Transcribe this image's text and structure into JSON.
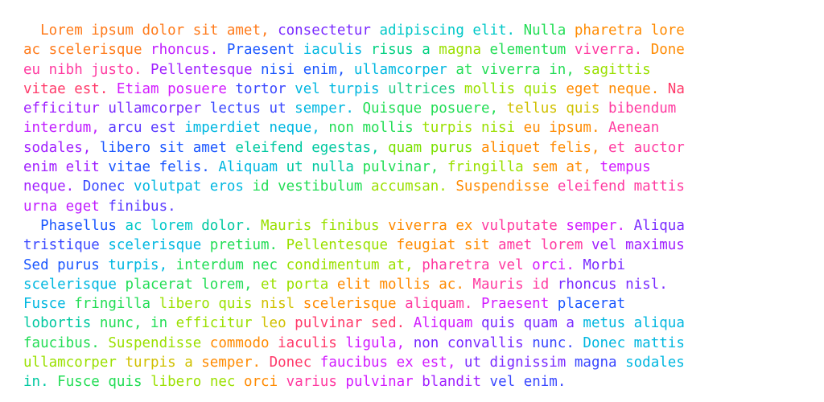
{
  "document": {
    "paragraphs": [
      {
        "lines": [
          [
            [
              "  Lorem ipsum dolor sit amet, ",
              "#ff7a1a"
            ],
            [
              "consectetur ",
              "#7a2bff"
            ],
            [
              "adipiscing elit. ",
              "#00c8c8"
            ],
            [
              "Nulla ",
              "#22dd55"
            ],
            [
              "pharetra lore",
              "#ff8a00"
            ]
          ],
          [
            [
              "ac scelerisque ",
              "#ff7a1a"
            ],
            [
              "rhoncus. ",
              "#c01cff"
            ],
            [
              "Praesent ",
              "#1a56ff"
            ],
            [
              "iaculis ",
              "#00b7e0"
            ],
            [
              "risus a ",
              "#00d080"
            ],
            [
              "magna ",
              "#9ae000"
            ],
            [
              "elementum ",
              "#22dd55"
            ],
            [
              "viverra. ",
              "#ff3aa0"
            ],
            [
              "Done",
              "#ff8a00"
            ]
          ],
          [
            [
              "eu nibh justo. ",
              "#ff3aa0"
            ],
            [
              "Pellentesque ",
              "#a020ff"
            ],
            [
              "nisi enim, ",
              "#1a56ff"
            ],
            [
              "ullamcorper ",
              "#00b7e0"
            ],
            [
              "at viverra in, ",
              "#22dd55"
            ],
            [
              "sagittis",
              "#9ae000"
            ]
          ],
          [
            [
              "vitae est. ",
              "#ff3a6a"
            ],
            [
              "Etiam posuere ",
              "#d21cff"
            ],
            [
              "tortor ",
              "#3a48ff"
            ],
            [
              "vel turpis ",
              "#00b7e0"
            ],
            [
              "ultrices ",
              "#22cc88"
            ],
            [
              "mollis quis ",
              "#9ae000"
            ],
            [
              "eget neque. ",
              "#ff8a00"
            ],
            [
              "Na",
              "#ff3a6a"
            ]
          ],
          [
            [
              "efficitur ",
              "#a020ff"
            ],
            [
              "ullamcorper ",
              "#7a2bff"
            ],
            [
              "lectus ut ",
              "#3a48ff"
            ],
            [
              "semper. ",
              "#00b7e0"
            ],
            [
              "Quisque posuere, ",
              "#22dd55"
            ],
            [
              "tellus quis ",
              "#d0c000"
            ],
            [
              "bibendum",
              "#ff3aa0"
            ]
          ],
          [
            [
              "interdum, ",
              "#c01cff"
            ],
            [
              "arcu est ",
              "#5a3aff"
            ],
            [
              "imperdiet neque, ",
              "#00b7e0"
            ],
            [
              "non mollis ",
              "#22dd55"
            ],
            [
              "turpis nisi ",
              "#9ae000"
            ],
            [
              "eu ipsum. ",
              "#ff8a00"
            ],
            [
              "Aenean",
              "#ff3aa0"
            ]
          ],
          [
            [
              "sodales, ",
              "#a020ff"
            ],
            [
              "libero sit amet ",
              "#1a56ff"
            ],
            [
              "eleifend egestas, ",
              "#00c8a0"
            ],
            [
              "quam purus ",
              "#7ae000"
            ],
            [
              "aliquet felis, ",
              "#ff8a00"
            ],
            [
              "et auctor",
              "#ff3aa0"
            ]
          ],
          [
            [
              "enim elit ",
              "#a020ff"
            ],
            [
              "vitae felis. ",
              "#1a56ff"
            ],
            [
              "Aliquam ",
              "#00b7e0"
            ],
            [
              "ut nulla ",
              "#00c8a0"
            ],
            [
              "pulvinar, ",
              "#22dd55"
            ],
            [
              "fringilla ",
              "#9ae000"
            ],
            [
              "sem at, ",
              "#ff8a00"
            ],
            [
              "tempus",
              "#d21cff"
            ]
          ],
          [
            [
              "neque. ",
              "#a020ff"
            ],
            [
              "Donec ",
              "#3a48ff"
            ],
            [
              "volutpat eros ",
              "#00b7e0"
            ],
            [
              "id vestibulum ",
              "#22dd55"
            ],
            [
              "accumsan. ",
              "#9ae000"
            ],
            [
              "Suspendisse ",
              "#ff8a00"
            ],
            [
              "eleifend mattis",
              "#ff3aa0"
            ]
          ],
          [
            [
              "urna eget ",
              "#c01cff"
            ],
            [
              "finibus.",
              "#5a3aff"
            ]
          ]
        ]
      },
      {
        "lines": [
          [
            [
              "  Phasellus ",
              "#1a56ff"
            ],
            [
              "ac lorem ",
              "#00c8c8"
            ],
            [
              "dolor. ",
              "#00c8a0"
            ],
            [
              "Mauris finibus ",
              "#9ae000"
            ],
            [
              "viverra ex ",
              "#ff8a00"
            ],
            [
              "vulputate ",
              "#ff3aa0"
            ],
            [
              "semper. ",
              "#d21cff"
            ],
            [
              "Aliqua",
              "#7a2bff"
            ]
          ],
          [
            [
              "tristique ",
              "#3a48ff"
            ],
            [
              "scelerisque ",
              "#00b7e0"
            ],
            [
              "pretium. ",
              "#22dd55"
            ],
            [
              "Pellentesque ",
              "#9ae000"
            ],
            [
              "feugiat sit ",
              "#ff8a00"
            ],
            [
              "amet lorem ",
              "#ff3aa0"
            ],
            [
              "vel maximus",
              "#a020ff"
            ]
          ],
          [
            [
              "Sed purus ",
              "#1a56ff"
            ],
            [
              "turpis, ",
              "#00b7e0"
            ],
            [
              "interdum nec ",
              "#22dd55"
            ],
            [
              "condimentum at, ",
              "#9ae000"
            ],
            [
              "pharetra vel ",
              "#ff3aa0"
            ],
            [
              "orci. ",
              "#d21cff"
            ],
            [
              "Morbi",
              "#7a2bff"
            ]
          ],
          [
            [
              "scelerisque ",
              "#00b7e0"
            ],
            [
              "placerat lorem, ",
              "#22dd55"
            ],
            [
              "et porta ",
              "#9ae000"
            ],
            [
              "elit mollis ac. ",
              "#ff8a00"
            ],
            [
              "Mauris id ",
              "#ff3aa0"
            ],
            [
              "rhoncus nisl.",
              "#7a2bff"
            ]
          ],
          [
            [
              "Fusce ",
              "#00b7e0"
            ],
            [
              "fringilla ",
              "#22dd55"
            ],
            [
              "libero quis ",
              "#9ae000"
            ],
            [
              "nisl ",
              "#d0c000"
            ],
            [
              "scelerisque ",
              "#ff8a00"
            ],
            [
              "aliquam. ",
              "#ff3aa0"
            ],
            [
              "Praesent ",
              "#d21cff"
            ],
            [
              "placerat",
              "#1a56ff"
            ]
          ],
          [
            [
              "lobortis ",
              "#00c8a0"
            ],
            [
              "nunc, in ",
              "#22dd55"
            ],
            [
              "efficitur ",
              "#9ae000"
            ],
            [
              "leo ",
              "#d0c000"
            ],
            [
              "pulvinar sed. ",
              "#ff3a6a"
            ],
            [
              "Aliquam ",
              "#d21cff"
            ],
            [
              "quis quam a ",
              "#7a2bff"
            ],
            [
              "metus aliqua",
              "#00b7e0"
            ]
          ],
          [
            [
              "faucibus. ",
              "#22dd55"
            ],
            [
              "Suspendisse ",
              "#9ae000"
            ],
            [
              "commodo ",
              "#ff8a00"
            ],
            [
              "iaculis ",
              "#ff3a6a"
            ],
            [
              "ligula, ",
              "#d21cff"
            ],
            [
              "non convallis ",
              "#7a2bff"
            ],
            [
              "nunc. ",
              "#3a48ff"
            ],
            [
              "Donec mattis",
              "#00b7e0"
            ]
          ],
          [
            [
              "ullamcorper ",
              "#9ae000"
            ],
            [
              "turpis a ",
              "#d0c000"
            ],
            [
              "semper. ",
              "#ff8a00"
            ],
            [
              "Donec ",
              "#ff3a6a"
            ],
            [
              "faucibus ex est, ",
              "#d21cff"
            ],
            [
              "ut dignissim ",
              "#7a2bff"
            ],
            [
              "magna ",
              "#3a48ff"
            ],
            [
              "sodales",
              "#00b7e0"
            ]
          ],
          [
            [
              "in. ",
              "#00c8a0"
            ],
            [
              "Fusce quis ",
              "#22dd55"
            ],
            [
              "libero nec ",
              "#9ae000"
            ],
            [
              "orci ",
              "#ff8a00"
            ],
            [
              "varius ",
              "#ff3aa0"
            ],
            [
              "pulvinar ",
              "#d21cff"
            ],
            [
              "blandit ",
              "#a020ff"
            ],
            [
              "vel enim.",
              "#3a48ff"
            ]
          ]
        ]
      }
    ]
  }
}
